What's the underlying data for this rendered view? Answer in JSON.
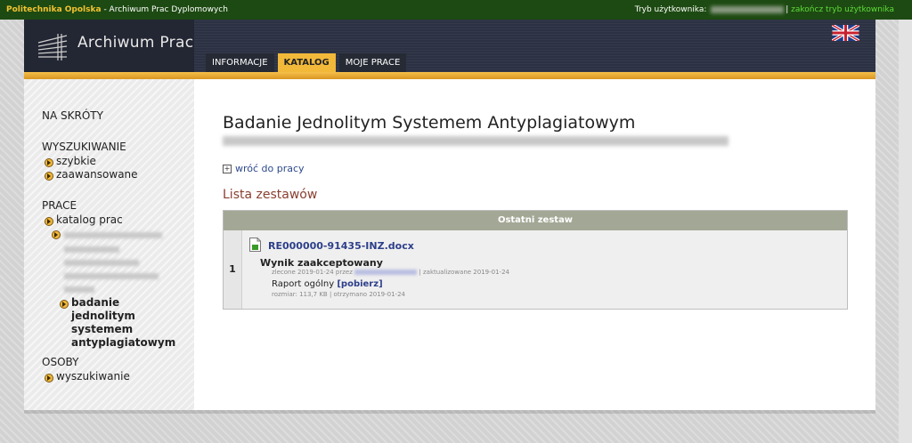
{
  "topbar": {
    "brand": "Politechnika Opolska",
    "app": "- Archiwum Prac Dyplomowych",
    "user_mode_label": "Tryb użytkownika:",
    "end_user_mode": "zakończ tryb użytkownika"
  },
  "header": {
    "logo_text": "Archiwum Prac",
    "tabs": [
      {
        "label": "INFORMACJE"
      },
      {
        "label": "KATALOG"
      },
      {
        "label": "MOJE PRACE"
      }
    ],
    "language_icon": "uk-flag-icon"
  },
  "sidebar": {
    "shortcuts": "NA SKRÓTY",
    "search_head": "WYSZUKIWANIE",
    "search_items": [
      "szybkie",
      "zaawansowane"
    ],
    "works_head": "PRACE",
    "works_catalog": "katalog prac",
    "works_current": "badanie jednolitym systemem antyplagiatowym",
    "people_head": "OSOBY",
    "people_items": [
      "wyszukiwanie"
    ]
  },
  "main": {
    "title": "Badanie Jednolitym Systemem Antyplagiatowym",
    "back_link": "wróć do pracy",
    "section_title": "Lista zestawów",
    "table_header": "Ostatni zestaw",
    "row": {
      "number": "1",
      "file_name": "RE000000-91435-INZ.docx",
      "status": "Wynik zaakceptowany",
      "ordered": "zlecone 2019-01-24 przez",
      "updated": "| zaktualizowane 2019-01-24",
      "report_label": "Raport ogólny",
      "download": "[pobierz]",
      "size_info": "rozmiar: 113,7 KB | otrzymano 2019-01-24"
    }
  },
  "colors": {
    "accent": "#f1b83a",
    "topbar": "#1d4a12",
    "header": "#2c3243",
    "link": "#2d3f8a"
  }
}
